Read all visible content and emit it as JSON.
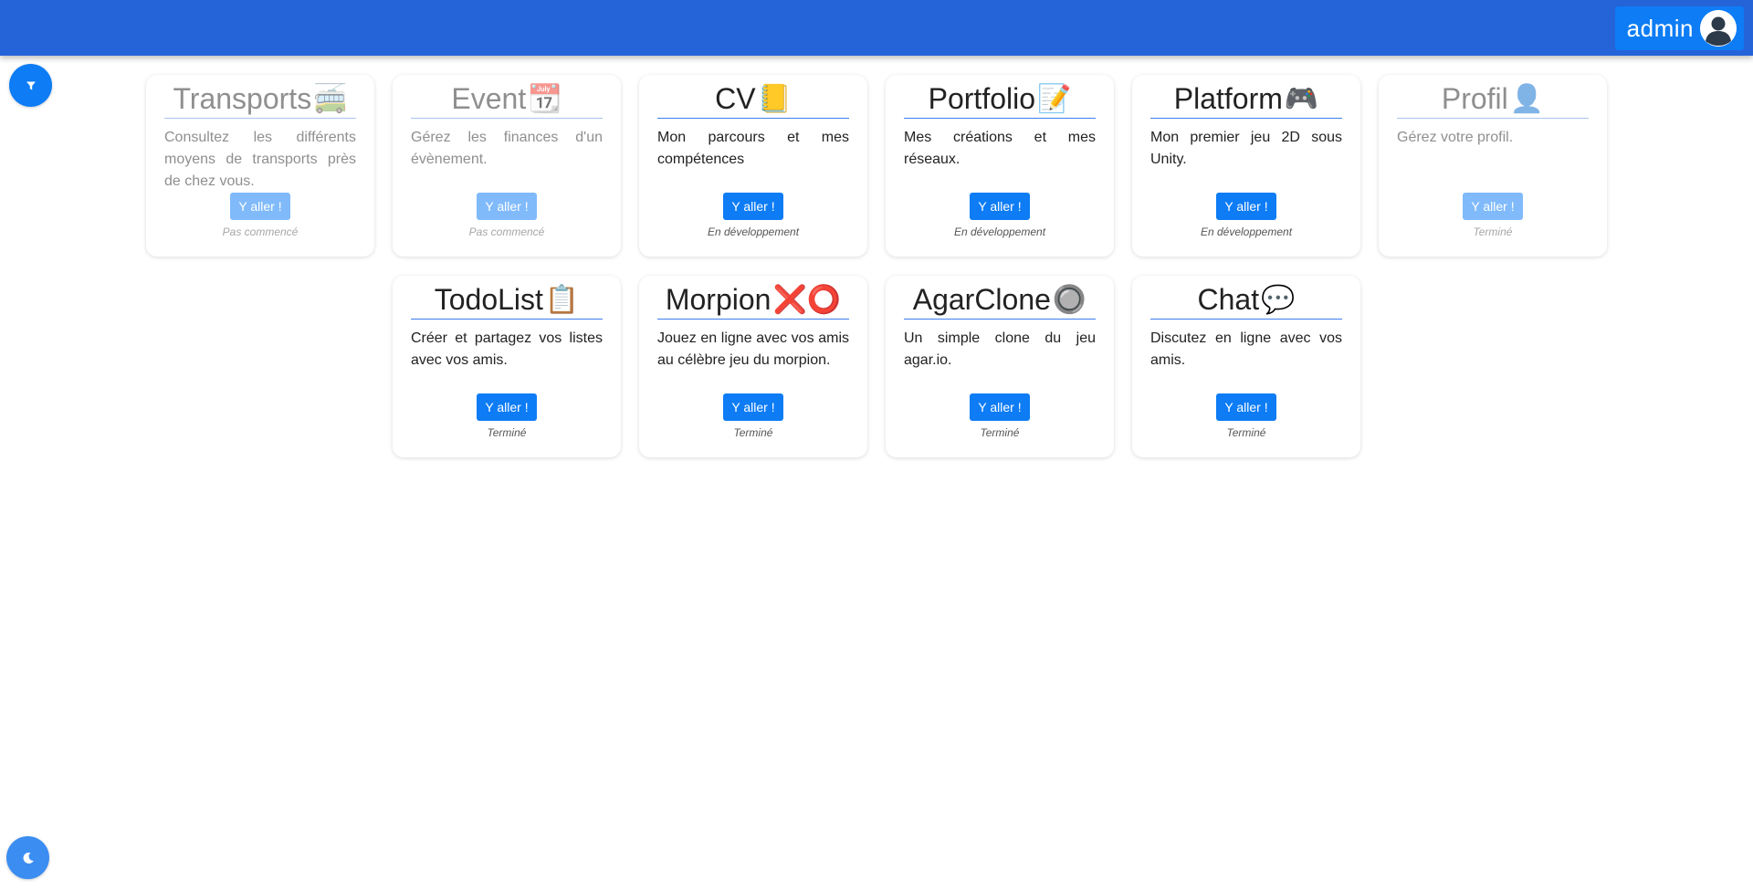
{
  "header": {
    "username": "admin",
    "accent_color": "#2563d9",
    "user_icon": "user-circle-icon"
  },
  "controls": {
    "filter_icon": "filter-icon",
    "theme_icon": "moon-icon"
  },
  "cards": [
    {
      "title": "Transports",
      "emoji": "🚎",
      "icon": "trolleybus-icon",
      "description": "Consultez les différents moyens de transports près de chez vous.",
      "button": "Y aller !",
      "status": "Pas commencé",
      "disabled": true
    },
    {
      "title": "Event",
      "emoji": "📆",
      "icon": "calendar-icon",
      "description": "Gérez les finances d'un évènement.",
      "button": "Y aller !",
      "status": "Pas commencé",
      "disabled": true
    },
    {
      "title": "CV",
      "emoji": "📒",
      "icon": "notebook-icon",
      "description": "Mon parcours et mes compétences",
      "button": "Y aller !",
      "status": "En développement",
      "disabled": false
    },
    {
      "title": "Portfolio",
      "emoji": "📝",
      "icon": "memo-icon",
      "description": "Mes créations et mes réseaux.",
      "button": "Y aller !",
      "status": "En développement",
      "disabled": false
    },
    {
      "title": "Platform",
      "emoji": "🎮",
      "icon": "gamepad-icon",
      "description": "Mon premier jeu 2D sous Unity.",
      "button": "Y aller !",
      "status": "En développement",
      "disabled": false
    },
    {
      "title": "Profil",
      "emoji": "👤",
      "icon": "profile-icon",
      "description": "Gérez votre profil.",
      "button": "Y aller !",
      "status": "Terminé",
      "disabled": true
    },
    {
      "title": "TodoList",
      "emoji": "📋",
      "icon": "clipboard-icon",
      "description": "Créer et partagez vos listes avec vos amis.",
      "button": "Y aller !",
      "status": "Terminé",
      "disabled": false
    },
    {
      "title": "Morpion",
      "emoji": "❌⭕",
      "icon": "cross-circle-icon",
      "description": "Jouez en ligne avec vos amis au célèbre jeu du morpion.",
      "button": "Y aller !",
      "status": "Terminé",
      "disabled": false
    },
    {
      "title": "AgarClone",
      "emoji": "🔘",
      "icon": "radio-button-icon",
      "description": "Un simple clone du jeu agar.io.",
      "button": "Y aller !",
      "status": "Terminé",
      "disabled": false
    },
    {
      "title": "Chat",
      "emoji": "💬",
      "icon": "speech-bubble-icon",
      "description": "Discutez en ligne avec vos amis.",
      "button": "Y aller !",
      "status": "Terminé",
      "disabled": false
    }
  ]
}
